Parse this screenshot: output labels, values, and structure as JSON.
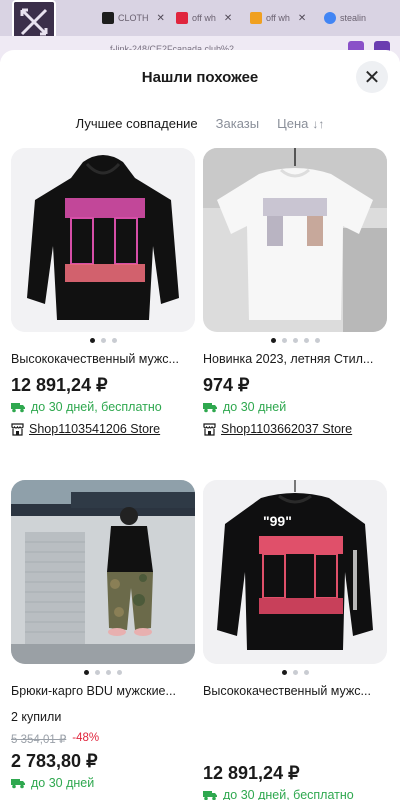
{
  "browser": {
    "tabs": [
      {
        "label": "CLOTH",
        "fav_color": "#1d1d1d"
      },
      {
        "label": "off wh",
        "fav_color": "#e0253d"
      },
      {
        "label": "off wh",
        "fav_color": "#f0a020"
      },
      {
        "label": "stealin",
        "fav_color": "#4285f4"
      }
    ],
    "url": "f-link-248/CE2Fcanada.club%2"
  },
  "sheet": {
    "title": "Нашли похожее",
    "close_icon": "close-icon"
  },
  "sort": {
    "options": [
      "Лучшее совпадение",
      "Заказы",
      "Цена"
    ],
    "active": "Лучшее совпадение",
    "price_icon": "sort-arrows-icon"
  },
  "products": [
    {
      "title": "Высококачественный мужс...",
      "price": "12 891,24 ₽",
      "delivery": "до 30 дней, бесплатно",
      "store": "Shop1103541206 Store",
      "image": "black-hoodie-pink-arrows",
      "dots": 3,
      "active_dot": 0
    },
    {
      "title": "Новинка 2023, летняя Стил...",
      "price": "974 ₽",
      "delivery": "до 30 дней",
      "store": "Shop1103662037 Store",
      "image": "white-tshirt-print",
      "dots": 5,
      "active_dot": 0
    },
    {
      "title": "Брюки-карго BDU мужские...",
      "sold": "2 купили",
      "old_price": "5 354,01 ₽",
      "discount": "-48%",
      "price": "2 783,80 ₽",
      "delivery": "до 30 дней",
      "image": "man-camo-cargo-pants",
      "dots": 4,
      "active_dot": 0
    },
    {
      "title": "Высококачественный мужс...",
      "price": "12 891,24 ₽",
      "delivery": "до 30 дней, бесплатно",
      "image": "black-sweatshirt-99",
      "dots": 3,
      "active_dot": 0
    }
  ],
  "colors": {
    "green": "#2fa84f",
    "red": "#e0253d",
    "muted": "#8a8f99"
  }
}
